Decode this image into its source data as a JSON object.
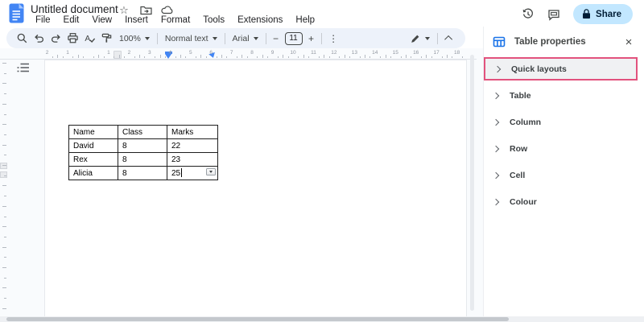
{
  "topbar": {
    "document_title": "Untitled document",
    "menus": [
      "File",
      "Edit",
      "View",
      "Insert",
      "Format",
      "Tools",
      "Extensions",
      "Help"
    ],
    "share_label": "Share"
  },
  "toolbar": {
    "zoom_value": "100%",
    "style_value": "Normal text",
    "font_value": "Arial",
    "font_size_value": "11",
    "font_size_decrease_glyph": "−",
    "font_size_increase_glyph": "+",
    "more_glyph": "⋮"
  },
  "ruler": {
    "left_numbers": [
      "2",
      "1"
    ],
    "numbers": [
      "1",
      "2",
      "3",
      "4",
      "5",
      "6",
      "7",
      "8",
      "9",
      "10",
      "11",
      "12",
      "13",
      "14",
      "15",
      "16",
      "17",
      "18"
    ]
  },
  "doc": {
    "table": {
      "headers": [
        "Name",
        "Class",
        "Marks"
      ],
      "rows": [
        [
          "David",
          "8",
          "22"
        ],
        [
          "Rex",
          "8",
          "23"
        ],
        [
          "Alicia",
          "8",
          "25"
        ]
      ]
    }
  },
  "panel": {
    "title": "Table properties",
    "close_glyph": "×",
    "sections": [
      "Quick layouts",
      "Table",
      "Column",
      "Row",
      "Cell",
      "Colour"
    ]
  },
  "colors": {
    "accent_blue": "#1a73e8",
    "docs_logo_blue": "#4285f4",
    "share_bg": "#c2e7ff",
    "share_text": "#001d35",
    "toolbar_bg": "#edf2fa",
    "canvas_bg": "#f9fbfd",
    "highlight_pink": "#e2527d"
  }
}
